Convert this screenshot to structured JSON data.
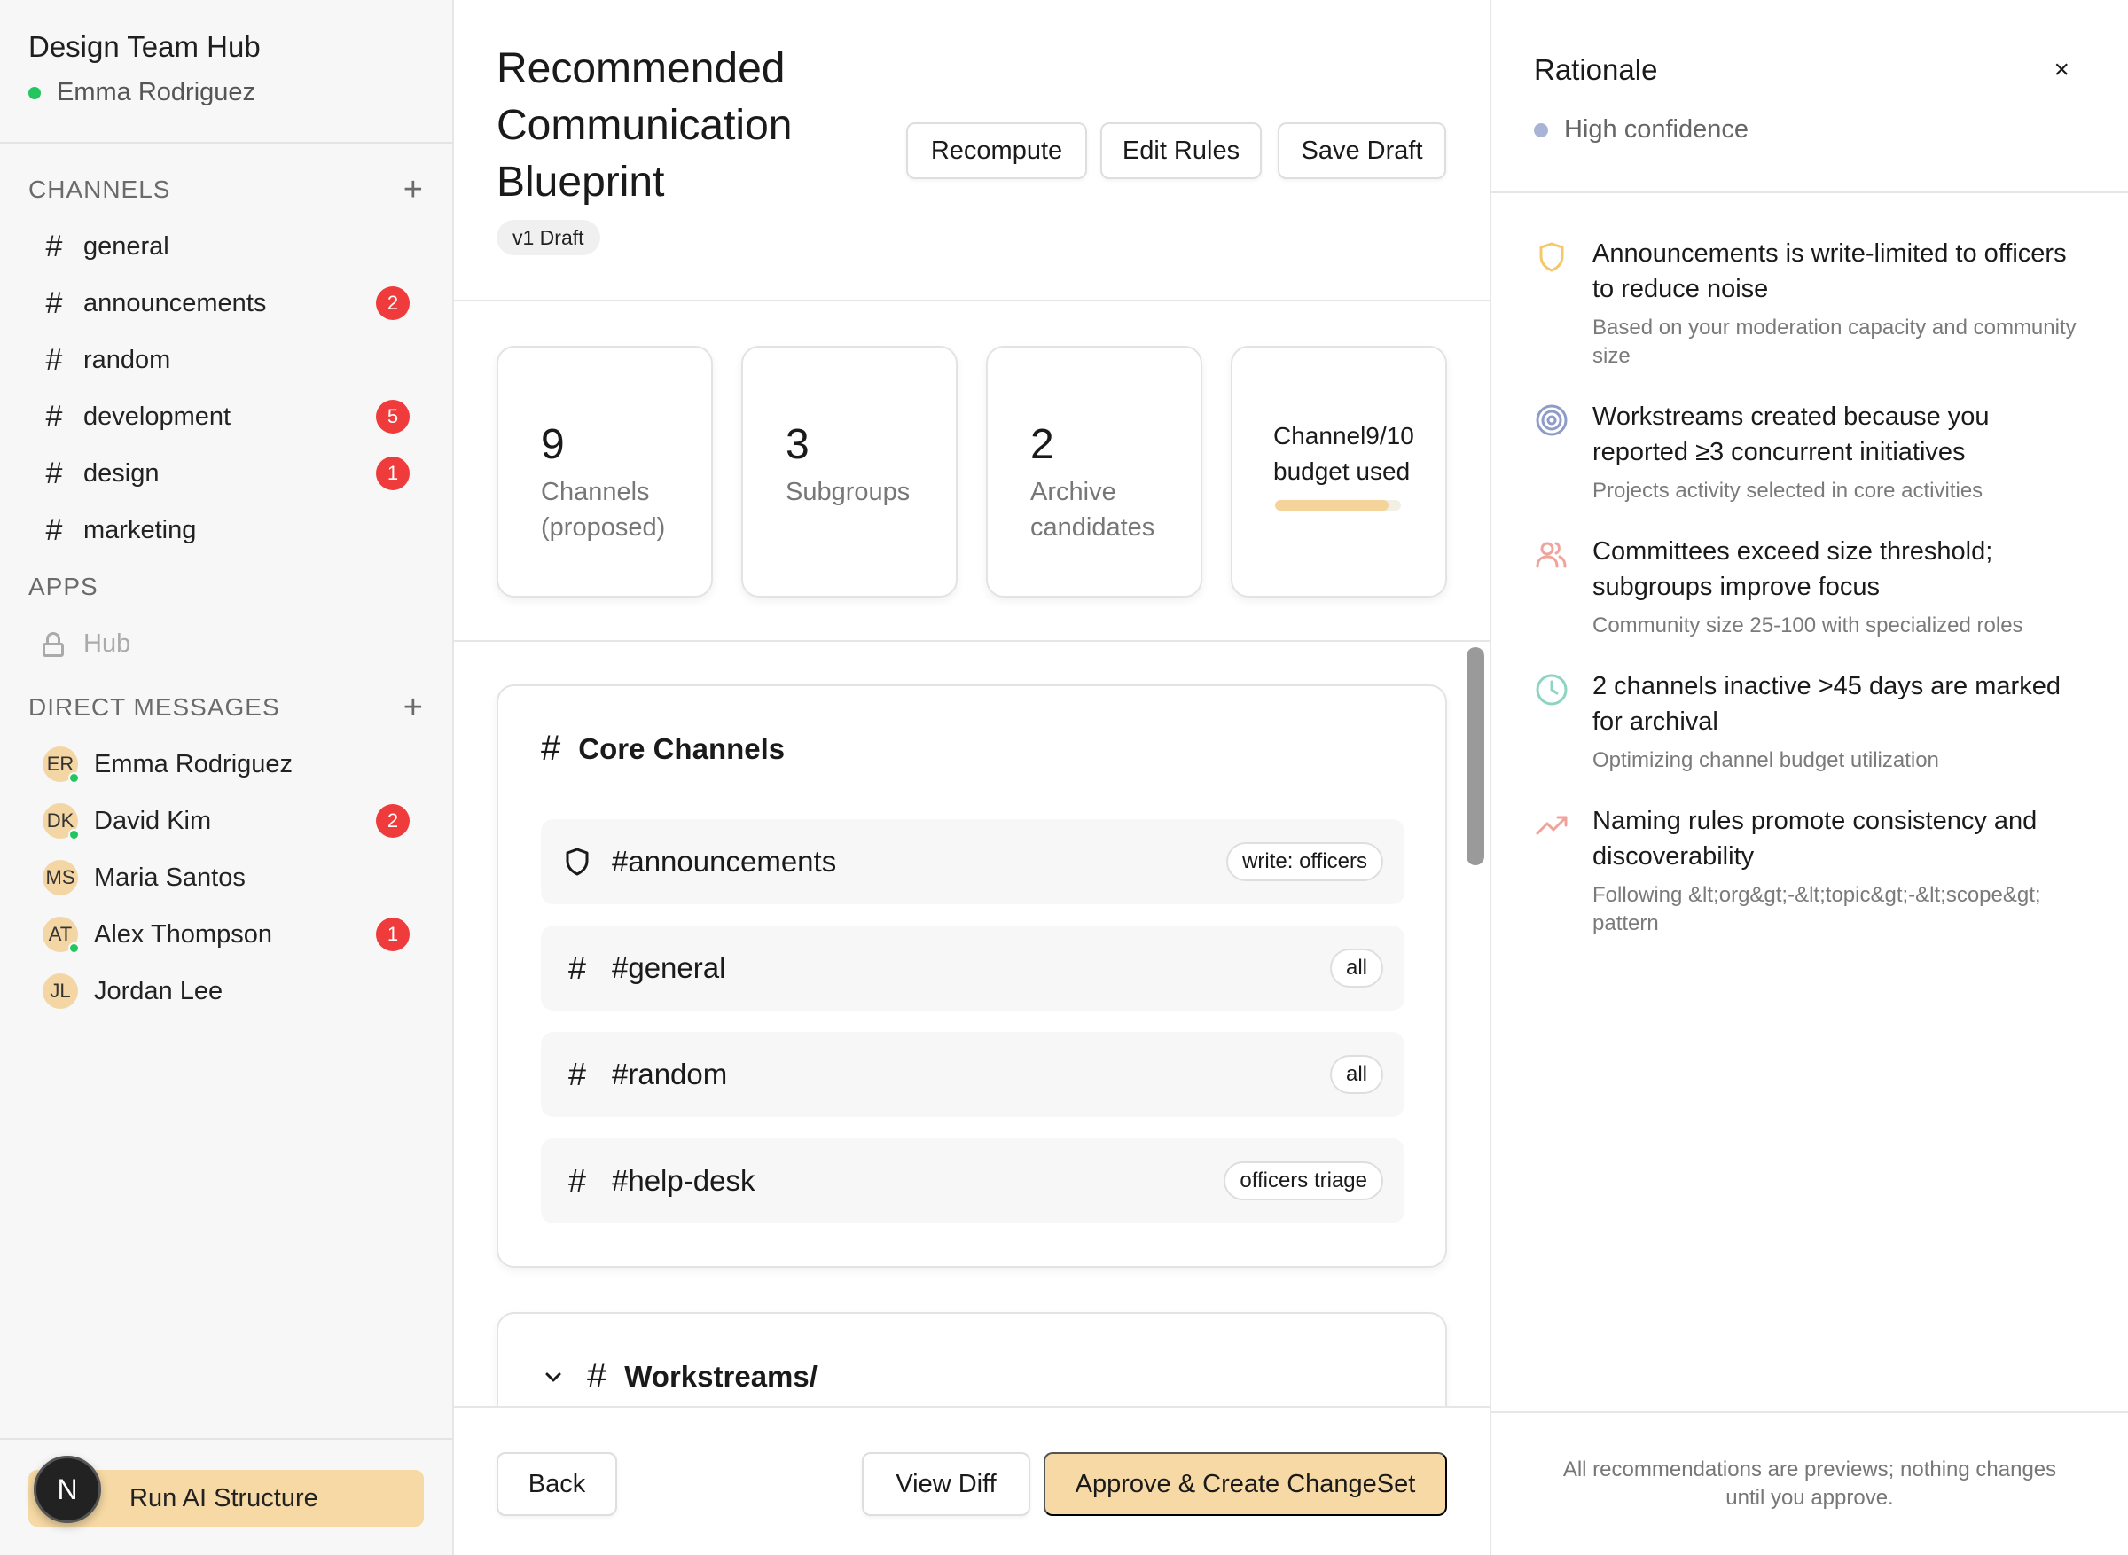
{
  "workspace": {
    "name": "Design Team Hub",
    "current_user": "Emma Rodriguez"
  },
  "sidebar": {
    "channels_heading": "CHANNELS",
    "channels": [
      {
        "name": "general",
        "badge": ""
      },
      {
        "name": "announcements",
        "badge": "2"
      },
      {
        "name": "random",
        "badge": ""
      },
      {
        "name": "development",
        "badge": "5"
      },
      {
        "name": "design",
        "badge": "1"
      },
      {
        "name": "marketing",
        "badge": ""
      }
    ],
    "apps_heading": "APPS",
    "apps": [
      {
        "name": "Hub",
        "icon": "lock-icon"
      }
    ],
    "dm_heading": "DIRECT MESSAGES",
    "dms": [
      {
        "initials": "ER",
        "name": "Emma Rodriguez",
        "online": true,
        "badge": ""
      },
      {
        "initials": "DK",
        "name": "David Kim",
        "online": true,
        "badge": "2"
      },
      {
        "initials": "MS",
        "name": "Maria Santos",
        "online": false,
        "badge": ""
      },
      {
        "initials": "AT",
        "name": "Alex Thompson",
        "online": true,
        "badge": "1"
      },
      {
        "initials": "JL",
        "name": "Jordan Lee",
        "online": false,
        "badge": ""
      }
    ],
    "run_button": "Run AI Structure",
    "fab_letter": "N"
  },
  "main": {
    "title": "Recommended Communication Blueprint",
    "version": "v1 Draft",
    "buttons": {
      "recompute": "Recompute",
      "edit_rules": "Edit Rules",
      "save_draft": "Save Draft"
    },
    "stats": [
      {
        "value": "9",
        "label": "Channels (proposed)"
      },
      {
        "value": "3",
        "label": "Subgroups"
      },
      {
        "value": "2",
        "label": "Archive candidates"
      }
    ],
    "budget": {
      "label": "Channel9/10 budget used",
      "fraction": 0.9
    },
    "core_section": {
      "title": "Core Channels",
      "rows": [
        {
          "name": "#announcements",
          "tag": "write: officers",
          "icon": "shield-icon"
        },
        {
          "name": "#general",
          "tag": "all",
          "icon": "hash-icon"
        },
        {
          "name": "#random",
          "tag": "all",
          "icon": "hash-icon"
        },
        {
          "name": "#help-desk",
          "tag": "officers triage",
          "icon": "hash-icon"
        }
      ]
    },
    "workstreams_section": {
      "title": "Workstreams/"
    },
    "footer": {
      "back": "Back",
      "view_diff": "View Diff",
      "approve": "Approve & Create ChangeSet"
    }
  },
  "rationale": {
    "title": "Rationale",
    "close": "×",
    "confidence": "High confidence",
    "items": [
      {
        "icon": "shield-icon",
        "color": "#f4c86a",
        "title": "Announcements is write-limited to officers to reduce noise",
        "sub": "Based on your moderation capacity and community size"
      },
      {
        "icon": "target-icon",
        "color": "#8e9cc9",
        "title": "Workstreams created because you reported ≥3 concurrent initiatives",
        "sub": "Projects activity selected in core activities"
      },
      {
        "icon": "users-icon",
        "color": "#f0a39a",
        "title": "Committees exceed size threshold; subgroups improve focus",
        "sub": "Community size 25-100 with specialized roles"
      },
      {
        "icon": "clock-icon",
        "color": "#8fd3c1",
        "title": "2 channels inactive >45 days are marked for archival",
        "sub": "Optimizing channel budget utilization"
      },
      {
        "icon": "trending-up-icon",
        "color": "#f0a39a",
        "title": "Naming rules promote consistency and discoverability",
        "sub": "Following &lt;org&gt;-&lt;topic&gt;-&lt;scope&gt; pattern"
      }
    ],
    "footer": "All recommendations are previews; nothing changes until you approve."
  }
}
